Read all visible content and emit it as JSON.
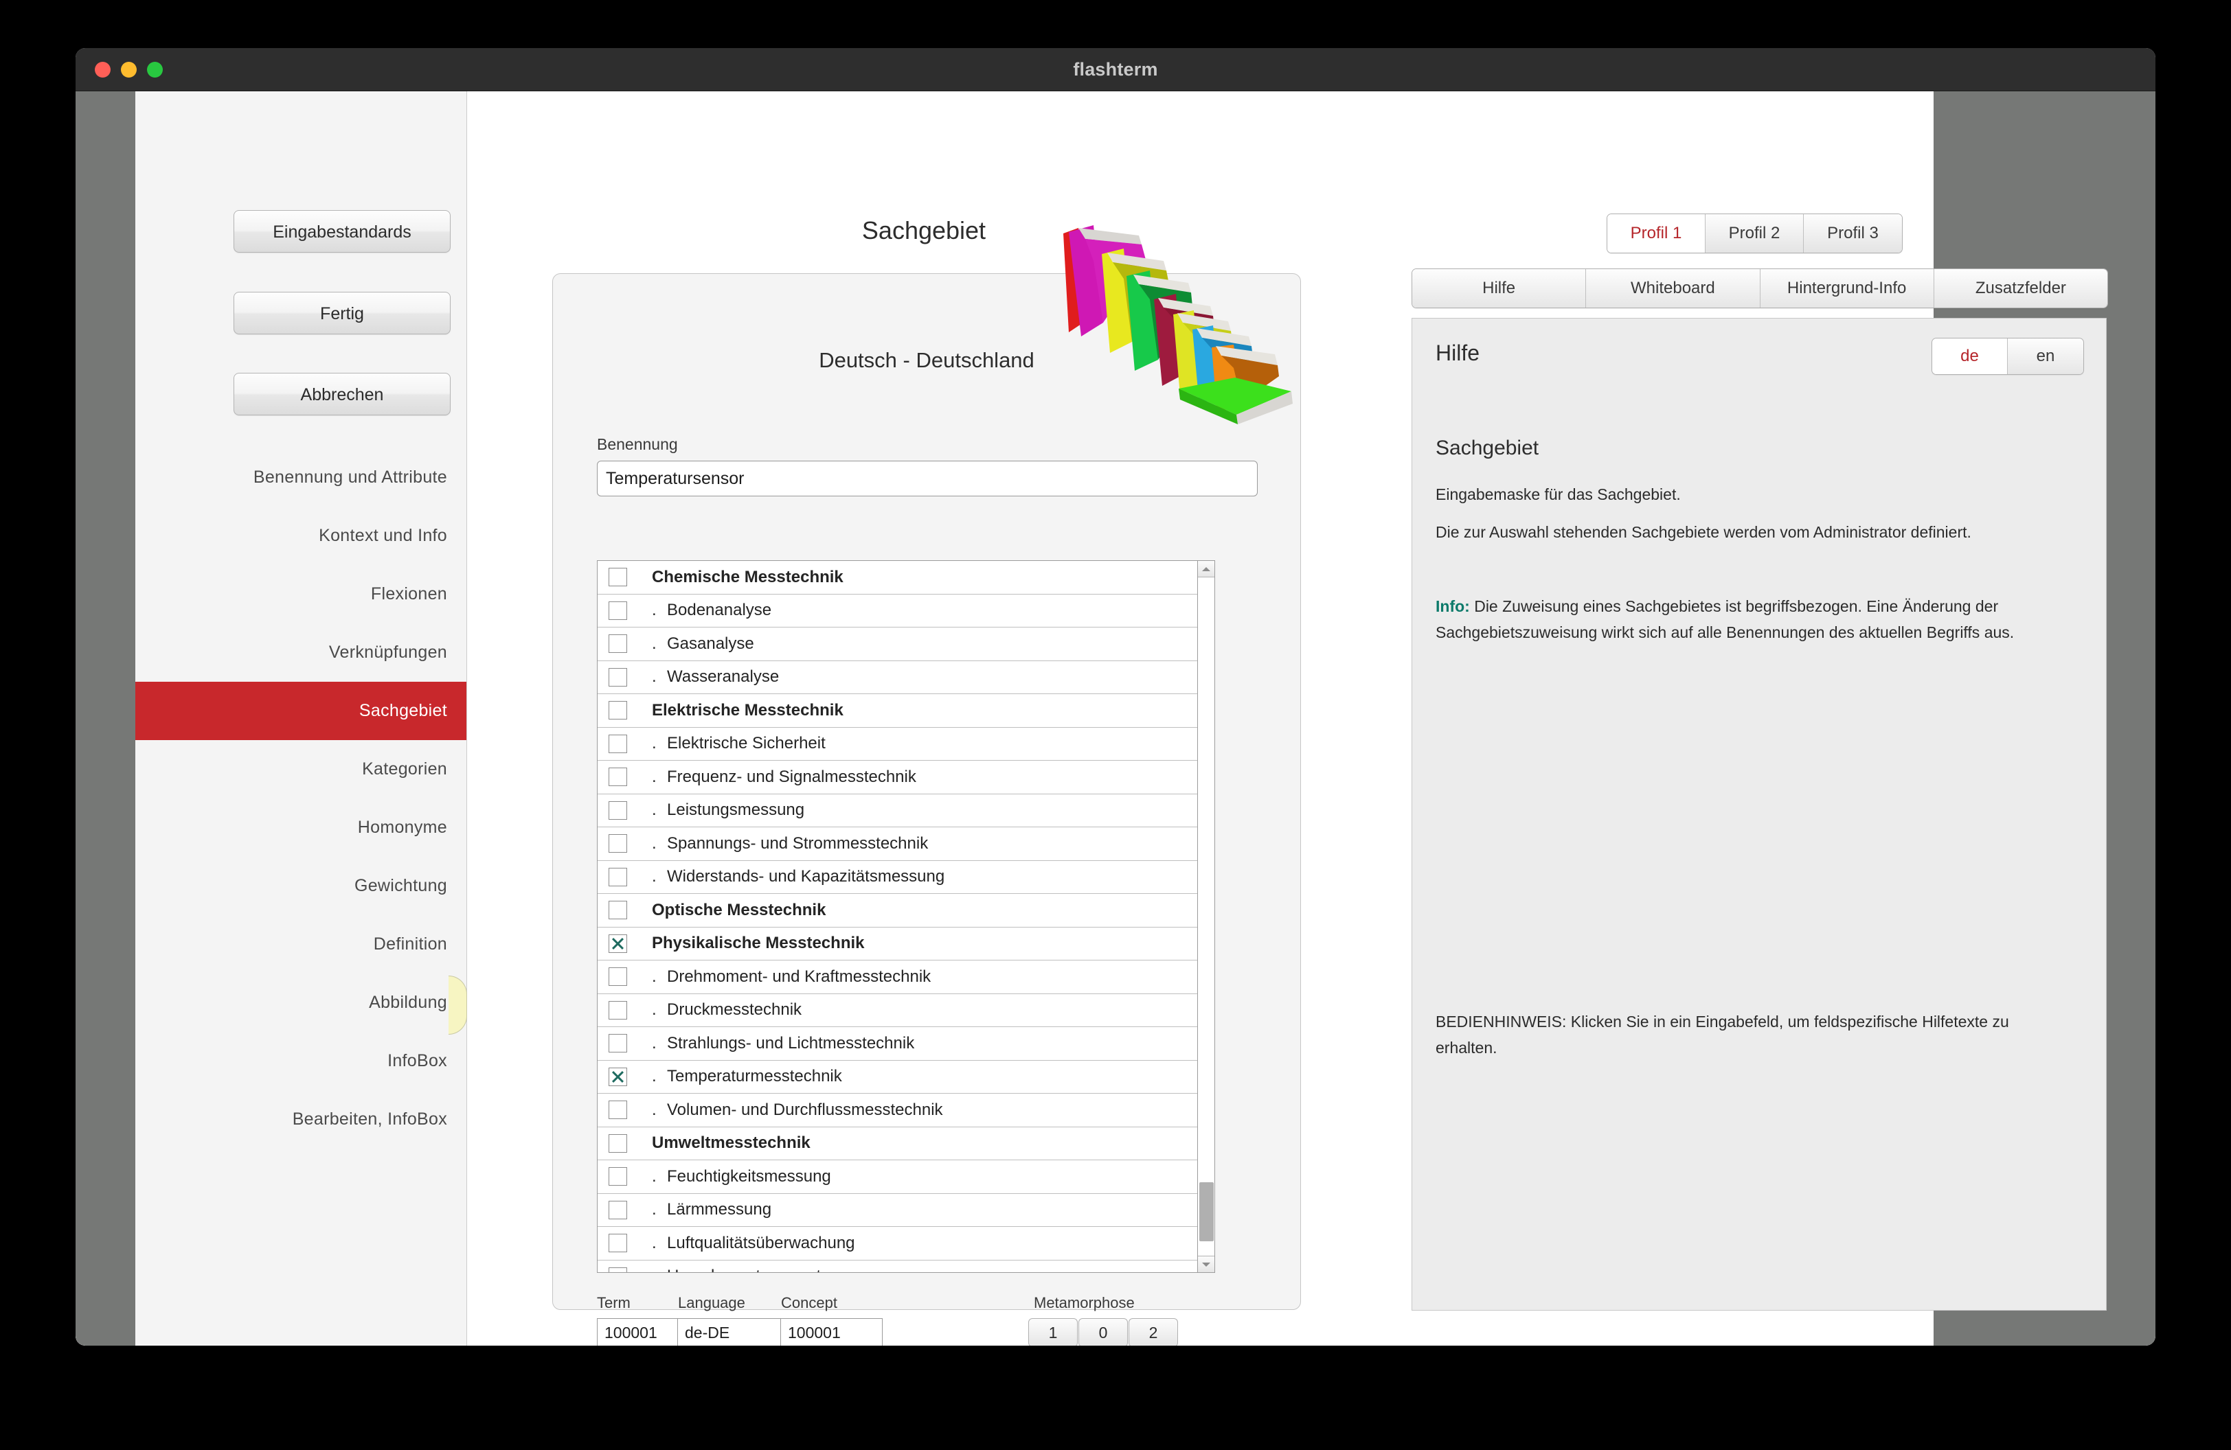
{
  "window": {
    "title": "flashterm",
    "traffic_lights": [
      "close",
      "minimize",
      "zoom"
    ]
  },
  "sidebar": {
    "buttons": [
      {
        "label": "Eingabestandards",
        "name": "eingabestandards"
      },
      {
        "label": "Fertig",
        "name": "fertig"
      },
      {
        "label": "Abbrechen",
        "name": "abbrechen"
      }
    ],
    "nav_items": [
      {
        "label": "Benennung und Attribute",
        "active": false
      },
      {
        "label": "Kontext und Info",
        "active": false
      },
      {
        "label": "Flexionen",
        "active": false
      },
      {
        "label": "Verknüpfungen",
        "active": false
      },
      {
        "label": "Sachgebiet",
        "active": true
      },
      {
        "label": "Kategorien",
        "active": false
      },
      {
        "label": "Homonyme",
        "active": false
      },
      {
        "label": "Gewichtung",
        "active": false
      },
      {
        "label": "Definition",
        "active": false
      },
      {
        "label": "Abbildung",
        "active": false
      },
      {
        "label": "InfoBox",
        "active": false
      },
      {
        "label": "Bearbeiten, InfoBox",
        "active": false
      }
    ],
    "active_color": "#c8282c"
  },
  "center": {
    "title": "Sachgebiet",
    "language_label": "Deutsch - Deutschland",
    "benennung_label": "Benennung",
    "benennung_value": "Temperatursensor",
    "list": [
      {
        "label": "Chemische Messtechnik",
        "group": true,
        "checked": false
      },
      {
        "label": "Bodenanalyse",
        "group": false,
        "checked": false
      },
      {
        "label": "Gasanalyse",
        "group": false,
        "checked": false
      },
      {
        "label": "Wasseranalyse",
        "group": false,
        "checked": false
      },
      {
        "label": "Elektrische Messtechnik",
        "group": true,
        "checked": false
      },
      {
        "label": "Elektrische Sicherheit",
        "group": false,
        "checked": false
      },
      {
        "label": "Frequenz- und Signalmesstechnik",
        "group": false,
        "checked": false
      },
      {
        "label": "Leistungsmessung",
        "group": false,
        "checked": false
      },
      {
        "label": "Spannungs- und Strommesstechnik",
        "group": false,
        "checked": false
      },
      {
        "label": "Widerstands- und Kapazitätsmessung",
        "group": false,
        "checked": false
      },
      {
        "label": "Optische Messtechnik",
        "group": true,
        "checked": false
      },
      {
        "label": "Physikalische Messtechnik",
        "group": true,
        "checked": true
      },
      {
        "label": "Drehmoment- und Kraftmesstechnik",
        "group": false,
        "checked": false
      },
      {
        "label": "Druckmesstechnik",
        "group": false,
        "checked": false
      },
      {
        "label": "Strahlungs- und Lichtmesstechnik",
        "group": false,
        "checked": false
      },
      {
        "label": "Temperaturmesstechnik",
        "group": false,
        "checked": true
      },
      {
        "label": "Volumen- und Durchflussmesstechnik",
        "group": false,
        "checked": false
      },
      {
        "label": "Umweltmesstechnik",
        "group": true,
        "checked": false
      },
      {
        "label": "Feuchtigkeitsmessung",
        "group": false,
        "checked": false
      },
      {
        "label": "Lärmmessung",
        "group": false,
        "checked": false
      },
      {
        "label": "Luftqualitätsüberwachung",
        "group": false,
        "checked": false
      },
      {
        "label": "Umgebungstemperaturmessung",
        "group": false,
        "checked": false
      }
    ],
    "sub_prefix": ".",
    "meta": {
      "term_label": "Term",
      "term_value": "100001",
      "language_label": "Language",
      "language_value": "de-DE",
      "concept_label": "Concept",
      "concept_value": "100001",
      "metamorphose_label": "Metamorphose",
      "metamorphose_values": [
        "1",
        "0",
        "2"
      ]
    }
  },
  "right": {
    "profile_tabs": [
      {
        "label": "Profil 1",
        "active": true
      },
      {
        "label": "Profil 2",
        "active": false
      },
      {
        "label": "Profil 3",
        "active": false
      }
    ],
    "panel_tabs": [
      {
        "label": "Hilfe",
        "active": true
      },
      {
        "label": "Whiteboard",
        "active": false
      },
      {
        "label": "Hintergrund-Info",
        "active": false
      },
      {
        "label": "Zusatzfelder",
        "active": false
      }
    ],
    "help": {
      "title": "Hilfe",
      "languages": [
        {
          "label": "de",
          "active": true
        },
        {
          "label": "en",
          "active": false
        }
      ],
      "heading": "Sachgebiet",
      "paragraph_1": "Eingabemaske für das Sachgebiet.",
      "paragraph_2": "Die zur Auswahl stehenden Sachgebiete werden vom Administrator definiert.",
      "info_keyword": "Info:",
      "info_text": " Die Zuweisung eines Sachgebietes ist begriffsbezogen. Eine Änderung der Sachgebietszuweisung wirkt sich auf alle Benennungen des aktuellen Begriffs aus.",
      "hint": "BEDIENHINWEIS: Klicken Sie in ein Eingabefeld, um feldspezifische Hilfetexte zu erhalten."
    },
    "accent_color": "#b5252a",
    "info_color": "#0c7a6a"
  }
}
